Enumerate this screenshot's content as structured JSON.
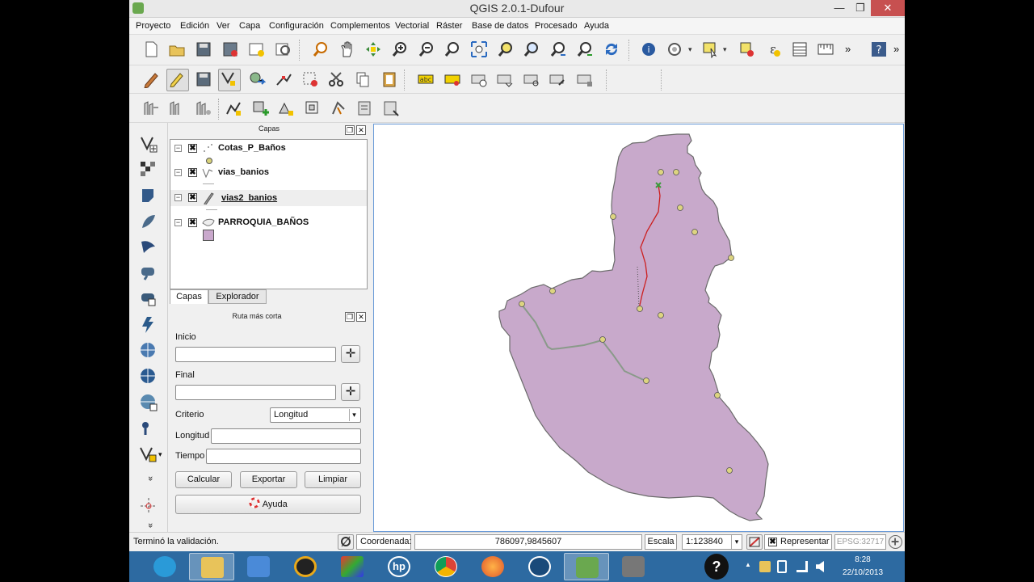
{
  "window": {
    "title": "QGIS 2.0.1-Dufour",
    "minimize_glyph": "—",
    "restore_glyph": "❐",
    "close_glyph": "✕"
  },
  "menu": [
    "Proyecto",
    "Edición",
    "Ver",
    "Capa",
    "Configuración",
    "Complementos",
    "Vectorial",
    "Ráster",
    "Base de datos",
    "Procesado",
    "Ayuda"
  ],
  "toolbar_overflow": "»",
  "layers_panel": {
    "title": "Capas",
    "layers": [
      {
        "name": "Cotas_P_Baños",
        "checked": "✖",
        "expander": "−",
        "icon": "point-layer-icon"
      },
      {
        "name": "vias_banios",
        "checked": "✖",
        "expander": "−",
        "icon": "line-layer-icon"
      },
      {
        "name": "vias2_banios",
        "checked": "✖",
        "expander": "−",
        "icon": "editing-pencil-icon"
      },
      {
        "name": "PARROQUIA_BAÑOS",
        "checked": "✖",
        "expander": "−",
        "icon": "polygon-layer-icon"
      }
    ],
    "fill_color": "#c9a8cc",
    "point_color": "#d8d27a"
  },
  "panel_buttons": {
    "float": "❐",
    "close": "✕"
  },
  "tabs": [
    "Capas",
    "Explorador"
  ],
  "route_panel": {
    "title": "Ruta más corta",
    "start_label": "Inicio",
    "start_value": "",
    "end_label": "Final",
    "end_value": "",
    "criterion_label": "Criterio",
    "criterion_value": "Longitud",
    "criterion_arrow": "▾",
    "length_label": "Longitud",
    "length_value": "",
    "time_label": "Tiempo",
    "time_value": "",
    "calc_button": "Calcular",
    "export_button": "Exportar",
    "clear_button": "Limpiar",
    "help_button": "Ayuda",
    "pick_glyph": "✛"
  },
  "left_toolbar": {
    "more_glyph_1": "»",
    "more_glyph_2": "»"
  },
  "status": {
    "message": "Terminó la validación.",
    "coord_label": "Coordenada:",
    "coord_value": "786097,9845607",
    "scale_label": "Escala",
    "scale_value": "1:123840",
    "render_label": "Representar",
    "render_check": "✖",
    "crs": "EPSG:32717"
  },
  "taskbar": {
    "time": "8:28",
    "date": "22/10/2013",
    "help_glyph": "?",
    "tray_arrow": "▲"
  },
  "map": {
    "polygon_fill": "#c8a9cb",
    "polygon_stroke": "#6b6b6b",
    "road_red": "#cc1f1f",
    "road_gray": "#8a9a8a",
    "point_fill": "#ddd480"
  }
}
